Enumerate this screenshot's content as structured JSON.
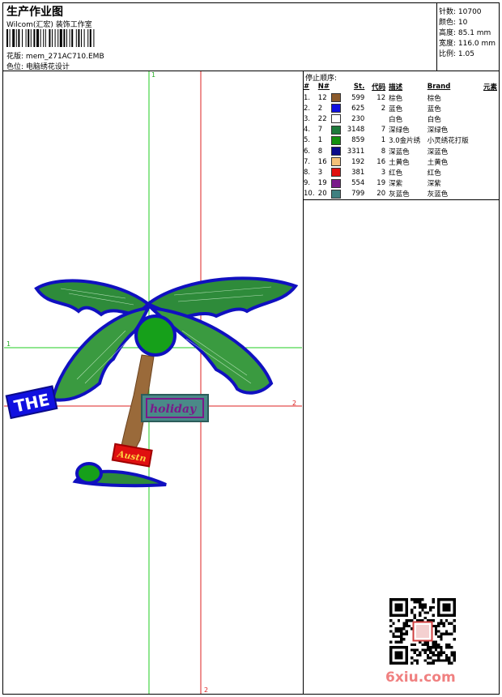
{
  "header": {
    "title": "生产作业图",
    "subtitle": "Wilcom(汇宏) 装饰工作室",
    "design_label": "花版:",
    "design_value": "mem_271AC710.EMB",
    "color_label": "色位:",
    "color_value": "电脑绣花设计"
  },
  "stats": {
    "stitches": "针数: 10700",
    "colors": "颜色: 10",
    "height": "高度: 85.1 mm",
    "width": "宽度: 116.0 mm",
    "scale": "比例: 1.05"
  },
  "sequence": {
    "title": "停止顺序:",
    "columns": [
      "#",
      "N#",
      "St.",
      "代码",
      "描述",
      "Brand",
      "元素"
    ],
    "rows": [
      {
        "idx": "1.",
        "n": "12",
        "color": "#8B5A2B",
        "st": "599",
        "code": "12",
        "desc": "棕色",
        "brand": "棕色"
      },
      {
        "idx": "2.",
        "n": "2",
        "color": "#1010E0",
        "st": "625",
        "code": "2",
        "desc": "蓝色",
        "brand": "蓝色"
      },
      {
        "idx": "3.",
        "n": "22",
        "color": "#FFFFFF",
        "st": "230",
        "code": "",
        "desc": "白色",
        "brand": "白色"
      },
      {
        "idx": "4.",
        "n": "7",
        "color": "#1E7A3C",
        "st": "3148",
        "code": "7",
        "desc": "深绿色",
        "brand": "深绿色"
      },
      {
        "idx": "5.",
        "n": "1",
        "color": "#12900F",
        "st": "859",
        "code": "1",
        "desc": "3.0金片绣",
        "brand": "小灵绣花打版"
      },
      {
        "idx": "6.",
        "n": "8",
        "color": "#0A0A8A",
        "st": "3311",
        "code": "8",
        "desc": "深蓝色",
        "brand": "深蓝色"
      },
      {
        "idx": "7.",
        "n": "16",
        "color": "#F5C078",
        "st": "192",
        "code": "16",
        "desc": "土黄色",
        "brand": "土黄色"
      },
      {
        "idx": "8.",
        "n": "3",
        "color": "#E01010",
        "st": "381",
        "code": "3",
        "desc": "红色",
        "brand": "红色"
      },
      {
        "idx": "9.",
        "n": "19",
        "color": "#7A1A8A",
        "st": "554",
        "code": "19",
        "desc": "深紫",
        "brand": "深紫"
      },
      {
        "idx": "10.",
        "n": "20",
        "color": "#3F8080",
        "st": "799",
        "code": "20",
        "desc": "灰蓝色",
        "brand": "灰蓝色"
      }
    ]
  },
  "guides": {
    "top_label": "1",
    "left_label": "1",
    "right_label": "2",
    "bottom_label": "2"
  },
  "design_text": {
    "badge": "THE",
    "sign": "holiday",
    "tag": "Austn"
  },
  "footer": {
    "logo": "6xiu.com"
  }
}
